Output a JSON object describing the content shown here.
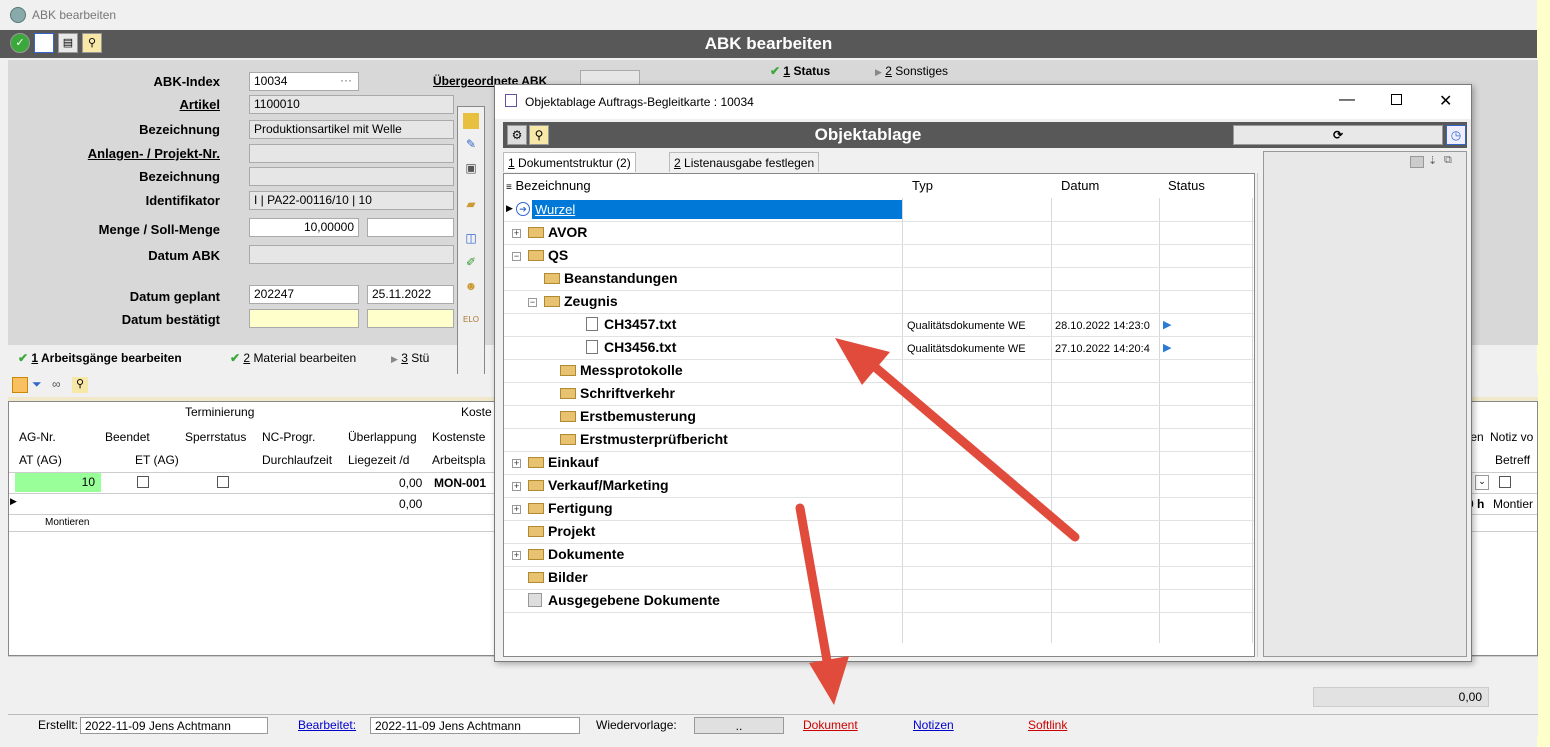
{
  "window": {
    "title": "ABK bearbeiten"
  },
  "header": {
    "title": "ABK bearbeiten"
  },
  "top_tabs": [
    {
      "num": "1",
      "label": "Status"
    },
    {
      "num": "2",
      "label": "Sonstiges"
    }
  ],
  "form": {
    "abk_index_label": "ABK-Index",
    "abk_index_value": "10034",
    "parent_label": "Übergeordnete ABK",
    "artikel_label": "Artikel",
    "artikel_value": "1100010",
    "bezeichnung_label": "Bezeichnung",
    "bezeichnung_value": "Produktionsartikel mit Welle",
    "anlagen_label": "Anlagen- / Projekt-Nr.",
    "bezeichnung2_label": "Bezeichnung",
    "identifikator_label": "Identifikator",
    "identifikator_value": "I | PA22-00116/10 | 10",
    "menge_label": "Menge / Soll-Menge",
    "menge_value": "10,00000",
    "datum_abk_label": "Datum ABK",
    "datum_geplant_label": "Datum geplant",
    "datum_geplant_week": "202247",
    "datum_geplant_date": "25.11.2022",
    "datum_bestaetigt_label": "Datum bestätigt"
  },
  "lower_tabs": [
    {
      "num": "1",
      "label": "Arbeitsgänge bearbeiten"
    },
    {
      "num": "2",
      "label": "Material bearbeiten"
    },
    {
      "num": "3",
      "label": "Stü"
    }
  ],
  "grid": {
    "group_terminierung": "Terminierung",
    "group_kosten": "Koste",
    "headers_row1": [
      "AG-Nr.",
      "Beendet",
      "Sperrstatus",
      "NC-Progr.",
      "Überlappung",
      "Kostenste"
    ],
    "headers_row2": [
      "AT (AG)",
      "ET (AG)",
      "Durchlaufzeit",
      "Liegezeit /d",
      "Arbeitspla"
    ],
    "right_headers_row1": [
      "ten",
      "Notiz vo"
    ],
    "right_headers_row2": [
      "Betreff"
    ],
    "row1": {
      "ag_nr": "10",
      "liegezeit": "0,00",
      "kostenstelle": "MON-001"
    },
    "row2": {
      "liegezeit": "0,00",
      "right_value": "0 h",
      "right_text": "Montier"
    },
    "row3": {
      "text": "Montieren"
    },
    "footer_value": "0,00"
  },
  "status_bar": {
    "erstellt_label": "Erstellt:",
    "erstellt_value": "2022-11-09  Jens Achtmann",
    "bearbeitet_label": "Bearbeitet:",
    "bearbeitet_value": "2022-11-09  Jens Achtmann",
    "wiedervorlage_label": "Wiedervorlage:",
    "wiedervorlage_value": "..",
    "dokument": "Dokument",
    "notizen": "Notizen",
    "softlink": "Softlink"
  },
  "dialog": {
    "title": "Objektablage Auftrags-Begleitkarte : 10034",
    "bar_title": "Objektablage",
    "tabs": [
      {
        "num": "1",
        "label": "Dokumentstruktur (2)"
      },
      {
        "num": "2",
        "label": "Listenausgabe festlegen"
      }
    ],
    "columns": [
      "Bezeichnung",
      "Typ",
      "Datum",
      "Status"
    ],
    "tree": [
      {
        "label": "Wurzel"
      },
      {
        "label": "AVOR"
      },
      {
        "label": "QS"
      },
      {
        "label": "Beanstandungen"
      },
      {
        "label": "Zeugnis"
      },
      {
        "label": "CH3457.txt",
        "typ": "Qualitätsdokumente WE",
        "datum": "28.10.2022 14:23:0"
      },
      {
        "label": "CH3456.txt",
        "typ": "Qualitätsdokumente WE",
        "datum": "27.10.2022 14:20:4"
      },
      {
        "label": "Messprotokolle"
      },
      {
        "label": "Schriftverkehr"
      },
      {
        "label": "Erstbemusterung"
      },
      {
        "label": "Erstmusterprüfbericht"
      },
      {
        "label": "Einkauf"
      },
      {
        "label": "Verkauf/Marketing"
      },
      {
        "label": "Fertigung"
      },
      {
        "label": "Projekt"
      },
      {
        "label": "Dokumente"
      },
      {
        "label": "Bilder"
      },
      {
        "label": "Ausgegebene Dokumente"
      }
    ]
  },
  "colors": {
    "header_bg": "#585858",
    "selection": "#0078d7",
    "arrow": "#e04b3c",
    "green_cell": "#99ff99"
  }
}
